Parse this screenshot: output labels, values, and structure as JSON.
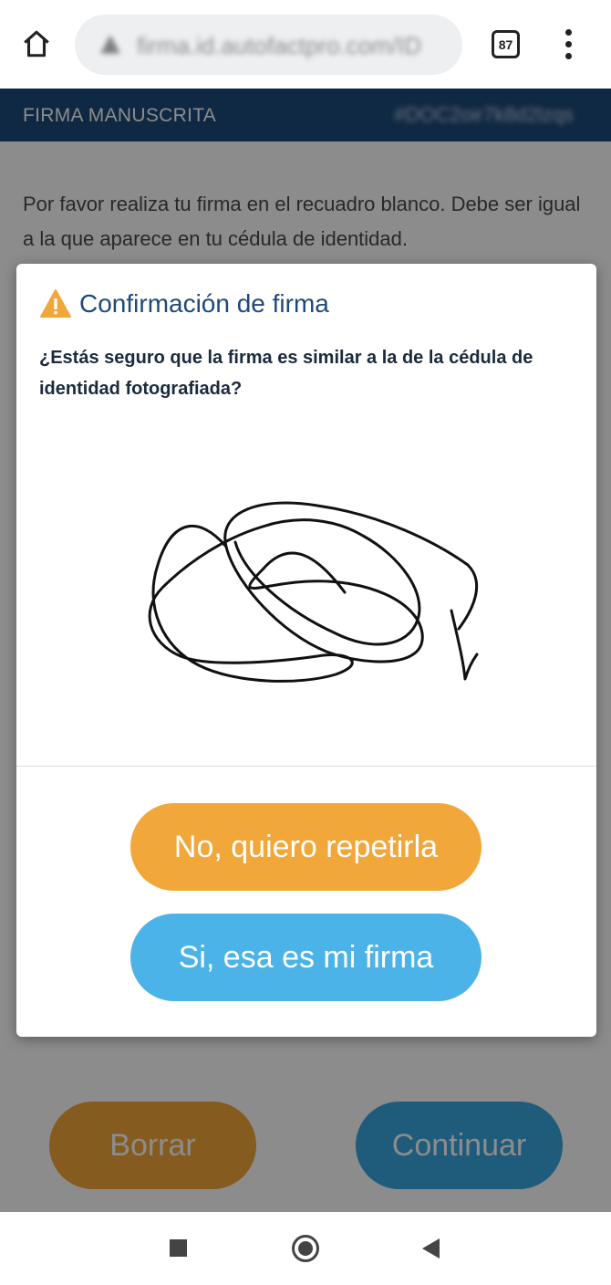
{
  "browser": {
    "url": "firma.id.autofactpro.com/ID",
    "tab_count": "87",
    "icons": [
      "home-icon",
      "lock-icon",
      "more-vert-icon"
    ]
  },
  "page": {
    "header_title": "FIRMA MANUSCRITA",
    "header_id": "#DOC2oir7k8d2lzqs",
    "instructions": "Por favor realiza tu firma en el recuadro blanco. Debe ser igual a la que aparece en tu cédula de identidad.",
    "borrar_label": "Borrar",
    "continuar_label": "Continuar"
  },
  "modal": {
    "title": "Confirmación de firma",
    "question": "¿Estás seguro que la firma es similar a la de la cédula de identidad fotografiada?",
    "no_label": "No, quiero repetirla",
    "yes_label": "Si, esa es mi firma"
  },
  "colors": {
    "header_blue": "#1d4a7a",
    "orange": "#f2a73a",
    "light_blue": "#4cb3e8",
    "warning": "#f2a73a"
  },
  "nav": {
    "icons": [
      "recents-icon",
      "home-circle-icon",
      "back-icon"
    ]
  }
}
